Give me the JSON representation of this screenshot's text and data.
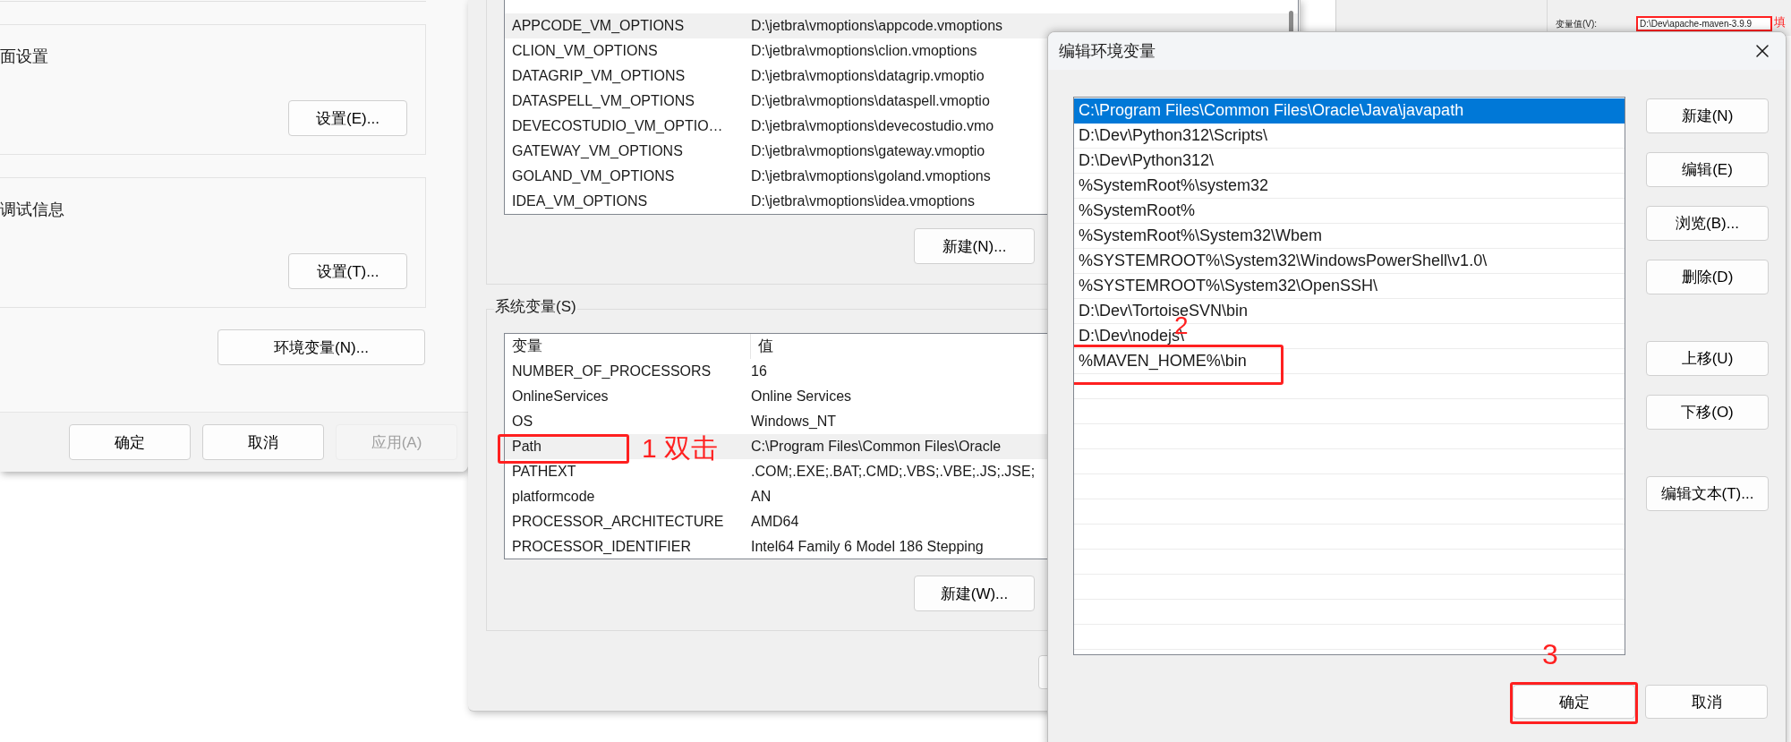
{
  "system_properties_window": {
    "groups": [
      {
        "label": "面设置",
        "button": "设置(E)..."
      },
      {
        "label": "调试信息",
        "button": "设置(T)..."
      }
    ],
    "env_button": "环境变量(N)...",
    "footer_buttons": [
      {
        "label": "确定",
        "disabled": false
      },
      {
        "label": "取消",
        "disabled": false
      },
      {
        "label": "应用(A)",
        "disabled": true
      }
    ]
  },
  "environment_variables_window": {
    "user_variables": {
      "rows": [
        {
          "name": "APPCODE_VM_OPTIONS",
          "value": "D:\\jetbra\\vmoptions\\appcode.vmoptions",
          "selected": true
        },
        {
          "name": "CLION_VM_OPTIONS",
          "value": "D:\\jetbra\\vmoptions\\clion.vmoptions",
          "selected": false
        },
        {
          "name": "DATAGRIP_VM_OPTIONS",
          "value": "D:\\jetbra\\vmoptions\\datagrip.vmoptio",
          "selected": false
        },
        {
          "name": "DATASPELL_VM_OPTIONS",
          "value": "D:\\jetbra\\vmoptions\\dataspell.vmoptio",
          "selected": false
        },
        {
          "name": "DEVECOSTUDIO_VM_OPTIO…",
          "value": "D:\\jetbra\\vmoptions\\devecostudio.vmo",
          "selected": false
        },
        {
          "name": "GATEWAY_VM_OPTIONS",
          "value": "D:\\jetbra\\vmoptions\\gateway.vmoptio",
          "selected": false
        },
        {
          "name": "GOLAND_VM_OPTIONS",
          "value": "D:\\jetbra\\vmoptions\\goland.vmoptions",
          "selected": false
        },
        {
          "name": "IDEA_VM_OPTIONS",
          "value": "D:\\jetbra\\vmoptions\\idea.vmoptions",
          "selected": false
        }
      ],
      "new_button": "新建(N)..."
    },
    "system_variables": {
      "title": "系统变量(S)",
      "columns": [
        "变量",
        "值"
      ],
      "rows": [
        {
          "name": "NUMBER_OF_PROCESSORS",
          "value": "16",
          "selected": false,
          "framed": false
        },
        {
          "name": "OnlineServices",
          "value": "Online Services",
          "selected": false,
          "framed": false
        },
        {
          "name": "OS",
          "value": "Windows_NT",
          "selected": false,
          "framed": false
        },
        {
          "name": "Path",
          "value": "C:\\Program Files\\Common Files\\Oracle",
          "selected": true,
          "framed": true,
          "annotation": "1 双击"
        },
        {
          "name": "PATHEXT",
          "value": ".COM;.EXE;.BAT;.CMD;.VBS;.VBE;.JS;.JSE;",
          "selected": false,
          "framed": false
        },
        {
          "name": "platformcode",
          "value": "AN",
          "selected": false,
          "framed": false
        },
        {
          "name": "PROCESSOR_ARCHITECTURE",
          "value": "AMD64",
          "selected": false,
          "framed": false
        },
        {
          "name": "PROCESSOR_IDENTIFIER",
          "value": "Intel64 Family 6 Model 186 Stepping",
          "selected": false,
          "framed": false
        }
      ],
      "new_button": "新建(W)..."
    }
  },
  "new_variable_window": {
    "value_label": "变量值(V):",
    "value": "D:\\Dev\\apache-maven-3.9.9",
    "framed": true,
    "annotation": "填"
  },
  "edit_dialog": {
    "title": "编辑环境变量",
    "items": [
      {
        "text": "C:\\Program Files\\Common Files\\Oracle\\Java\\javapath",
        "selected": true,
        "framed": false
      },
      {
        "text": "D:\\Dev\\Python312\\Scripts\\",
        "selected": false,
        "framed": false
      },
      {
        "text": "D:\\Dev\\Python312\\",
        "selected": false,
        "framed": false
      },
      {
        "text": "%SystemRoot%\\system32",
        "selected": false,
        "framed": false
      },
      {
        "text": "%SystemRoot%",
        "selected": false,
        "framed": false
      },
      {
        "text": "%SystemRoot%\\System32\\Wbem",
        "selected": false,
        "framed": false
      },
      {
        "text": "%SYSTEMROOT%\\System32\\WindowsPowerShell\\v1.0\\",
        "selected": false,
        "framed": false
      },
      {
        "text": "%SYSTEMROOT%\\System32\\OpenSSH\\",
        "selected": false,
        "framed": false
      },
      {
        "text": "D:\\Dev\\TortoiseSVN\\bin",
        "selected": false,
        "framed": false
      },
      {
        "text": "D:\\Dev\\nodejs\\",
        "selected": false,
        "framed": false
      },
      {
        "text": "%MAVEN_HOME%\\bin",
        "selected": false,
        "framed": true,
        "annotation": "2"
      }
    ],
    "button_groups": [
      [
        "新建(N)",
        "编辑(E)",
        "浏览(B)...",
        "删除(D)"
      ],
      [
        "上移(U)",
        "下移(O)"
      ],
      [
        "编辑文本(T)..."
      ]
    ],
    "footer_buttons": [
      {
        "label": "确定",
        "framed": true,
        "annotation": "3"
      },
      {
        "label": "取消",
        "framed": false
      }
    ]
  }
}
